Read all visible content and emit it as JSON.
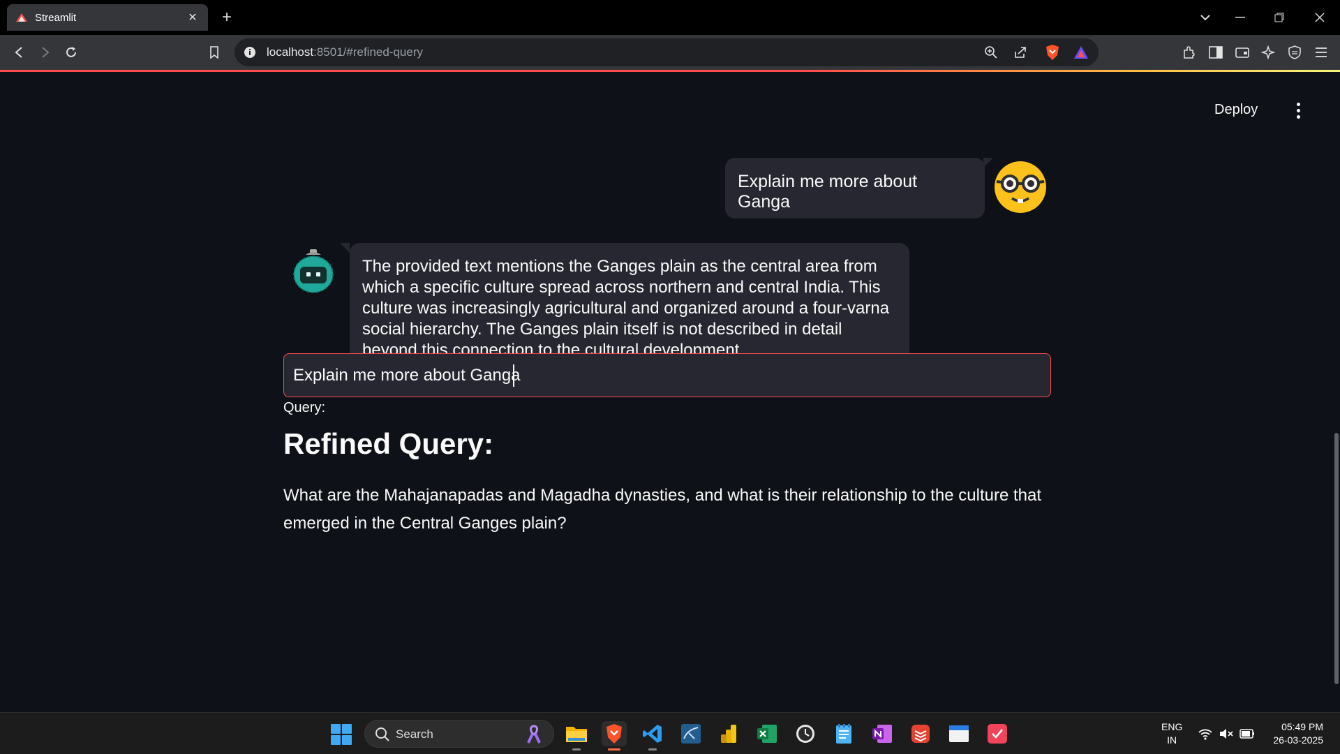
{
  "browser": {
    "tab_title": "Streamlit",
    "new_tab_label": "+",
    "url_host": "localhost",
    "url_rest": ":8501/#refined-query"
  },
  "app": {
    "deploy_label": "Deploy",
    "chat": {
      "user_message": "Explain me more about Ganga",
      "assistant_message": "The provided text mentions the Ganges plain as the central area from which a specific culture spread across northern and central India. This culture was increasingly agricultural and organized around a four-varna social hierarchy. The Ganges plain itself is not described in detail beyond this connection to the cultural development."
    },
    "query": {
      "label": "Query:",
      "value": "Explain me more about Ganga"
    },
    "refined": {
      "title": "Refined Query:",
      "text": "What are the Mahajanapadas and Magadha dynasties, and what is their relationship to the culture that emerged in the Central Ganges plain?"
    },
    "colors": {
      "background": "#0e1117",
      "bubble": "#262730",
      "accent": "#ff4b4b"
    }
  },
  "taskbar": {
    "search_label": "Search",
    "apps": [
      "file-explorer",
      "brave-browser",
      "vscode",
      "mysql-workbench",
      "power-bi",
      "excel",
      "clock",
      "notepad",
      "onenote",
      "todoist",
      "calendar-app",
      "screen-snip"
    ],
    "lang_line1": "ENG",
    "lang_line2": "IN",
    "time": "05:49 PM",
    "date": "26-03-2025"
  }
}
